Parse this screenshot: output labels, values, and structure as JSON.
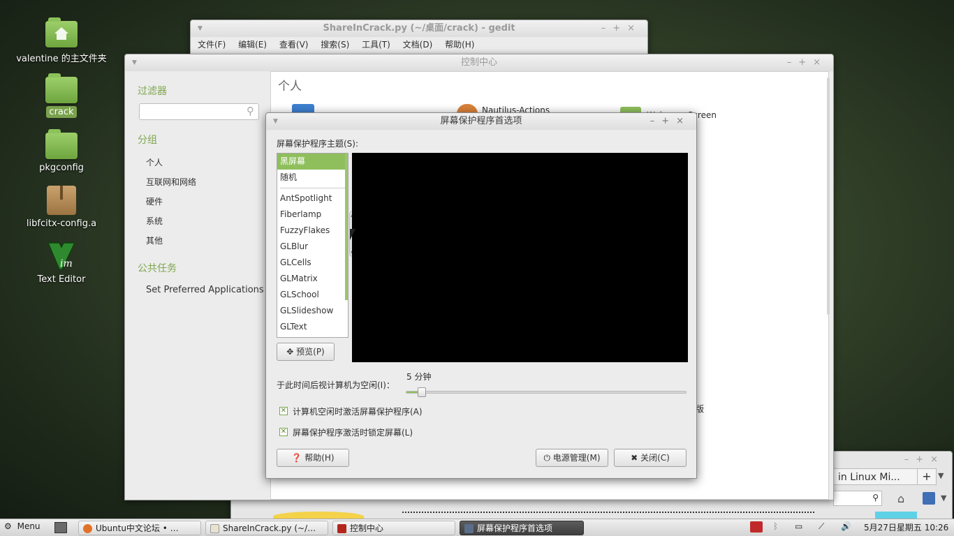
{
  "desktop": {
    "icons": [
      {
        "label": "valentine 的主文件夹"
      },
      {
        "label": "crack"
      },
      {
        "label": "pkgconfig"
      },
      {
        "label": "libfcitx-config.a"
      },
      {
        "label": "Text Editor"
      }
    ]
  },
  "gedit": {
    "title": "ShareInCrack.py (~/桌面/crack) - gedit",
    "menus": [
      "文件(F)",
      "编辑(E)",
      "查看(V)",
      "搜索(S)",
      "工具(T)",
      "文档(D)",
      "帮助(H)"
    ]
  },
  "control_center": {
    "title": "控制中心",
    "filter_heading": "过滤器",
    "group_heading": "分组",
    "groups": [
      "个人",
      "互联网和网络",
      "硬件",
      "系统",
      "其他"
    ],
    "tasks_heading": "公共任务",
    "task_item": "Set Preferred Applications",
    "section_title": "个人",
    "visible_items": [
      "Nautilus-Actions",
      "Welcome Screen"
    ],
    "partial_text": "版"
  },
  "dialog": {
    "title": "屏幕保护程序首选项",
    "theme_label": "屏幕保护程序主题(S):",
    "themes": [
      "黑屏幕",
      "随机",
      "AntSpotlight",
      "Fiberlamp",
      "FuzzyFlakes",
      "GLBlur",
      "GLCells",
      "GLMatrix",
      "GLSchool",
      "GLSlideshow",
      "GLText"
    ],
    "selected_theme": "黑屏幕",
    "preview_button": "预览(P)",
    "idle_label": "于此时间后视计算机为空闲(I)：",
    "idle_value": "5 分钟",
    "idle_fraction": 0.04,
    "check_activate": "计算机空闲时激活屏幕保护程序(A)",
    "check_lock": "屏幕保护程序激活时锁定屏幕(L)",
    "help_button": "帮助(H)",
    "power_button": "电源管理(M)",
    "close_button": "关闭(C)"
  },
  "browser_partial": {
    "tab_text": "in Linux Mi..."
  },
  "taskbar": {
    "menu_label": "Menu",
    "tasks": [
      "Ubuntu中文论坛 • …",
      "ShareInCrack.py (~/…",
      "控制中心",
      "屏幕保护程序首选项"
    ],
    "clock": "5月27日星期五 10:26"
  }
}
